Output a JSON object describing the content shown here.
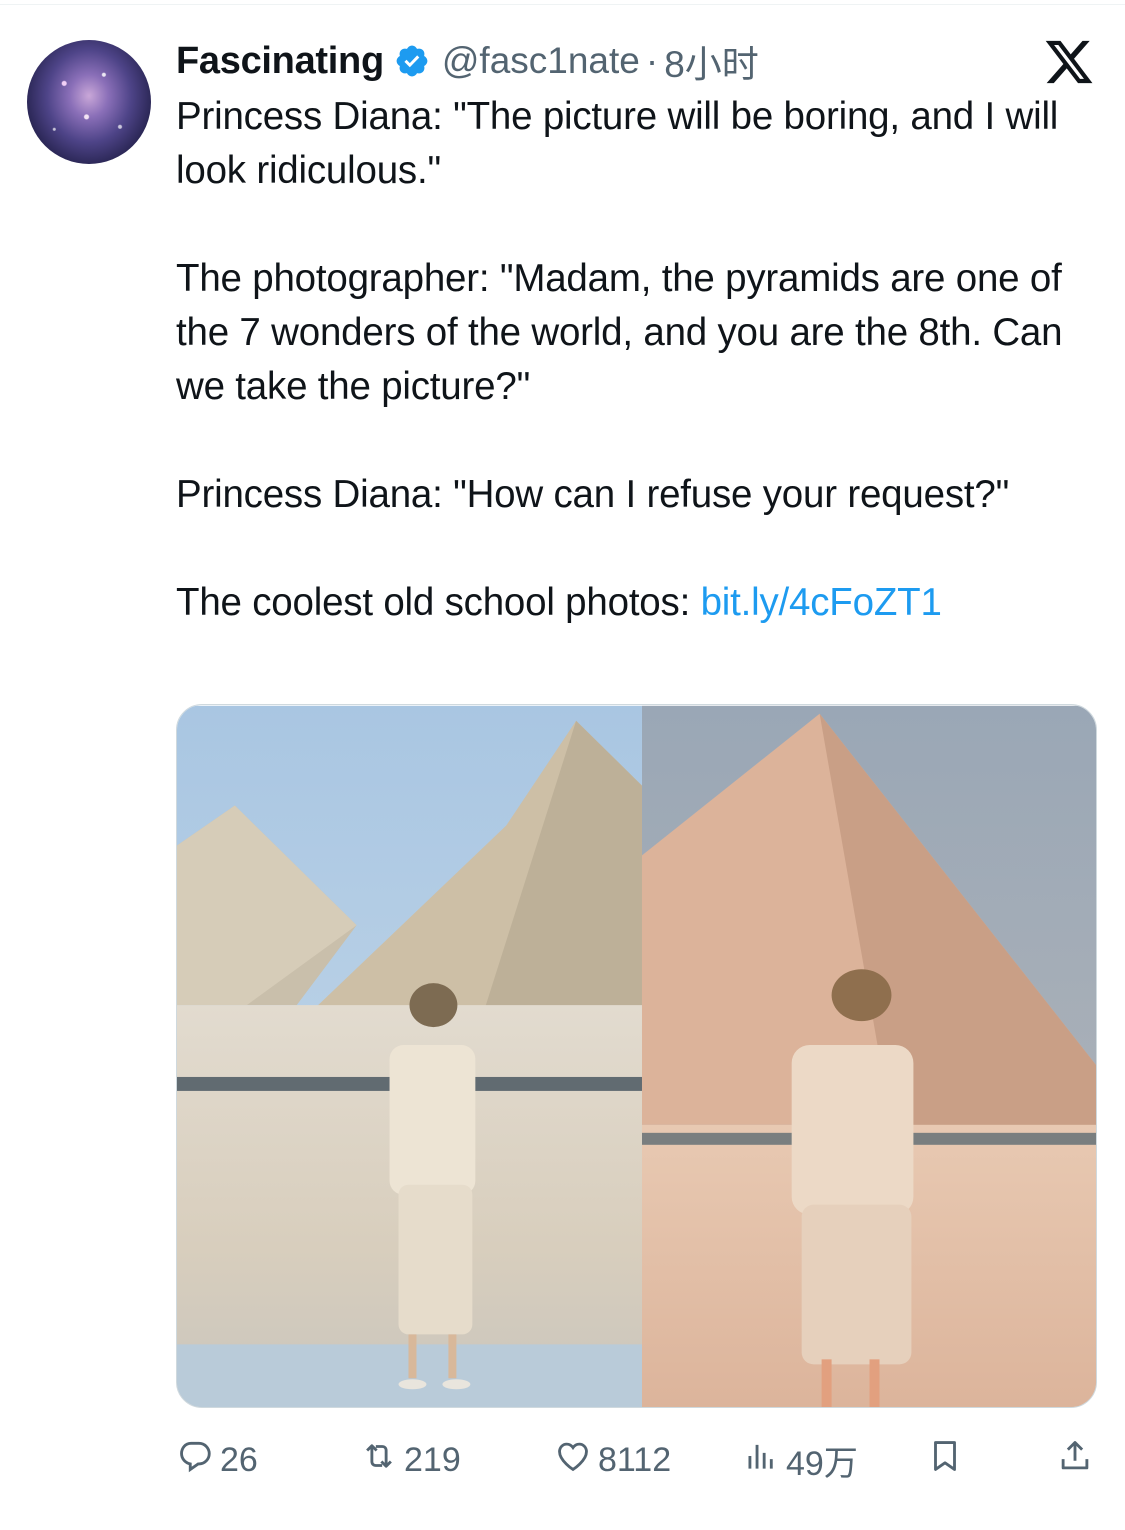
{
  "tweet": {
    "display_name": "Fascinating",
    "handle": "@fasc1nate",
    "separator": "·",
    "time": "8小时",
    "lines": [
      "Princess Diana: \"The picture will be boring, and I will look ridiculous.\"",
      "The photographer: \"Madam, the pyramids are one of the 7 wonders of the world, and you are the 8th. Can we take the picture?\"",
      "Princess Diana: \"How can I refuse your request?\""
    ],
    "promo_text": "The coolest old school photos: ",
    "promo_link": "bit.ly/4cFoZT1"
  },
  "actions": {
    "replies": "26",
    "reposts": "219",
    "likes": "8112",
    "views": "49万"
  },
  "icons": {
    "verified": "verified-badge-icon",
    "platform": "x-logo-icon",
    "reply": "reply-icon",
    "repost": "repost-icon",
    "like": "heart-icon",
    "views": "views-icon",
    "bookmark": "bookmark-icon",
    "share": "share-icon"
  },
  "colors": {
    "link": "#1d9bf0",
    "verified": "#1d9bf0",
    "secondary_text": "#536471"
  }
}
